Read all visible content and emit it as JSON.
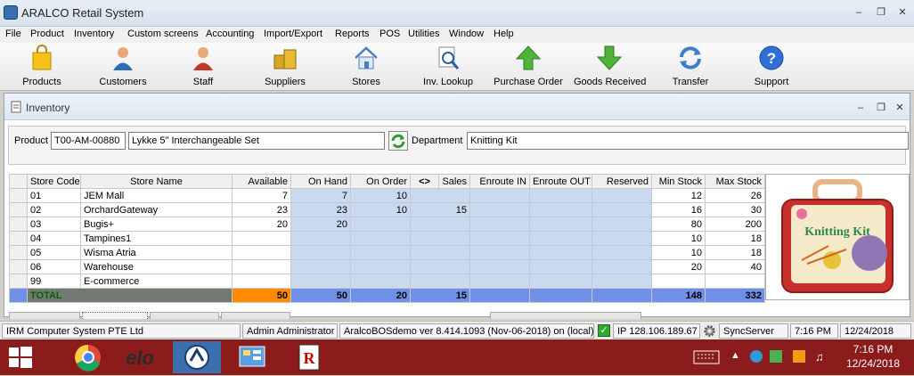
{
  "window": {
    "title": "ARALCO Retail System"
  },
  "menu": [
    "File",
    "Product",
    "Inventory",
    "Custom screens",
    "Accounting",
    "Import/Export",
    "Reports",
    "POS",
    "Utilities",
    "Window",
    "Help"
  ],
  "toolbar": [
    {
      "label": "Products",
      "icon": "shopping-bag-icon"
    },
    {
      "label": "Customers",
      "icon": "customer-person-icon"
    },
    {
      "label": "Staff",
      "icon": "staff-person-icon"
    },
    {
      "label": "Suppliers",
      "icon": "boxes-icon"
    },
    {
      "label": "Stores",
      "icon": "house-icon"
    },
    {
      "label": "Inv. Lookup",
      "icon": "magnifier-document-icon"
    },
    {
      "label": "Purchase Order",
      "icon": "arrow-up-icon"
    },
    {
      "label": "Goods Received",
      "icon": "arrow-down-icon"
    },
    {
      "label": "Transfer",
      "icon": "refresh-arrows-icon"
    },
    {
      "label": "Support",
      "icon": "help-circle-icon"
    }
  ],
  "inventory": {
    "title": "Inventory",
    "product_label": "Product",
    "product_code": "T00-AM-00880",
    "product_name": "Lykke 5\" Interchangeable Set",
    "department_label": "Department",
    "department": "Knitting Kit",
    "columns": [
      "Store Code",
      "Store Name",
      "Available",
      "On Hand",
      "On Order",
      "<>",
      "Sales",
      "Enroute IN",
      "Enroute OUT",
      "Reserved",
      "Min Stock",
      "Max Stock"
    ],
    "rows": [
      {
        "code": "01",
        "name": "JEM Mall",
        "available": "7",
        "on_hand": "7",
        "on_order": "10",
        "sales": "",
        "enroute_in": "",
        "enroute_out": "",
        "reserved": "",
        "min": "12",
        "max": "26"
      },
      {
        "code": "02",
        "name": "OrchardGateway",
        "available": "23",
        "on_hand": "23",
        "on_order": "10",
        "sales": "15",
        "enroute_in": "",
        "enroute_out": "",
        "reserved": "",
        "min": "16",
        "max": "30"
      },
      {
        "code": "03",
        "name": "Bugis+",
        "available": "20",
        "on_hand": "20",
        "on_order": "",
        "sales": "",
        "enroute_in": "",
        "enroute_out": "",
        "reserved": "",
        "min": "80",
        "max": "200"
      },
      {
        "code": "04",
        "name": "Tampines1",
        "available": "",
        "on_hand": "",
        "on_order": "",
        "sales": "",
        "enroute_in": "",
        "enroute_out": "",
        "reserved": "",
        "min": "10",
        "max": "18"
      },
      {
        "code": "05",
        "name": "Wisma Atria",
        "available": "",
        "on_hand": "",
        "on_order": "",
        "sales": "",
        "enroute_in": "",
        "enroute_out": "",
        "reserved": "",
        "min": "10",
        "max": "18"
      },
      {
        "code": "06",
        "name": "Warehouse",
        "available": "",
        "on_hand": "",
        "on_order": "",
        "sales": "",
        "enroute_in": "",
        "enroute_out": "",
        "reserved": "",
        "min": "20",
        "max": "40"
      },
      {
        "code": "99",
        "name": "E-commerce",
        "available": "",
        "on_hand": "",
        "on_order": "",
        "sales": "",
        "enroute_in": "",
        "enroute_out": "",
        "reserved": "",
        "min": "",
        "max": ""
      }
    ],
    "total": {
      "label": "TOTAL",
      "available": "50",
      "on_hand": "50",
      "on_order": "20",
      "sales": "15",
      "min": "148",
      "max": "332"
    },
    "image_text": "Knitting Kit"
  },
  "status": {
    "company": "IRM Computer System PTE Ltd",
    "user": "Admin Administrator",
    "version": "AralcoBOSdemo ver 8.414.1093 (Nov-06-2018) on (local)",
    "ip": "IP 128.106.189.67",
    "sync": "SyncServer",
    "time": "7:16 PM",
    "date": "12/24/2018"
  },
  "taskbar": {
    "time": "7:16 PM",
    "date": "12/24/2018"
  }
}
